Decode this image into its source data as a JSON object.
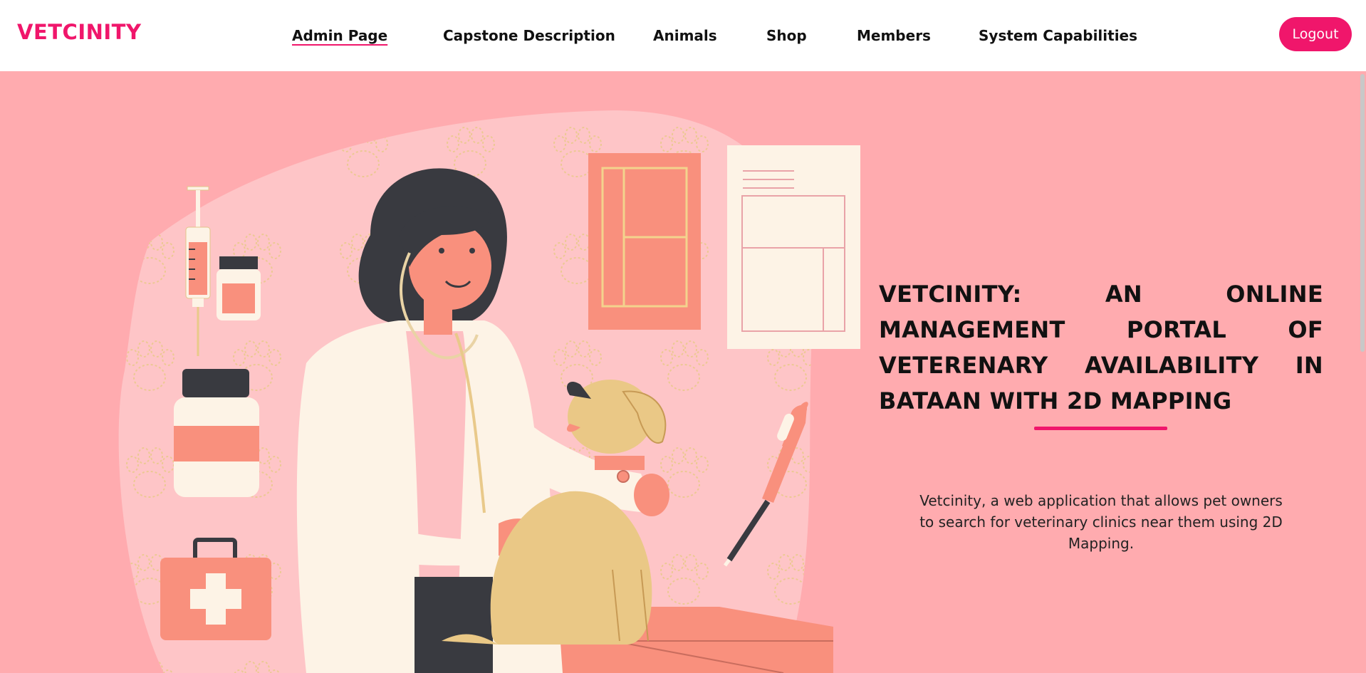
{
  "brand": {
    "name": "VETCINITY"
  },
  "nav": {
    "items": [
      {
        "label": "Admin Page",
        "active": true
      },
      {
        "label": "Capstone Description",
        "active": false
      },
      {
        "label": "Animals",
        "active": false
      },
      {
        "label": "Shop",
        "active": false
      },
      {
        "label": "Members",
        "active": false
      },
      {
        "label": "System Capabilities",
        "active": false
      }
    ],
    "logout_label": "Logout"
  },
  "hero": {
    "title": "VETCINITY: AN ONLINE MANAGEMENT PORTAL OF VETERENARY AVAILABILITY IN BATAAN WITH 2D MAPPING",
    "description": "Vetcinity, a web application that allows pet owners to search for veterinary clinics near them using 2D Mapping.",
    "illustration_icons": [
      "veterinarian-icon",
      "puppy-icon",
      "syringe-icon",
      "medicine-bottle-icon",
      "first-aid-kit-icon",
      "thermometer-icon",
      "paw-print-icon"
    ]
  },
  "colors": {
    "accent": "#f0166b",
    "background": "#ffabaf",
    "blob": "#fec5c7",
    "salmon": "#f9907d",
    "cream": "#fdf3e6",
    "dark": "#393a40",
    "dog": "#eac886"
  }
}
